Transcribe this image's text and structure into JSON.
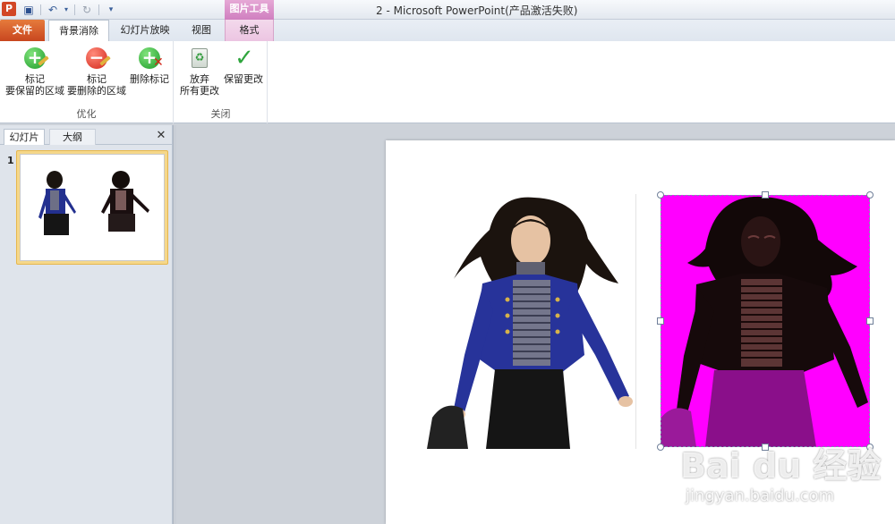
{
  "titlebar": {
    "app_icon_letter": "P",
    "title": "2 - Microsoft PowerPoint(产品激活失败)",
    "context_group_label": "图片工具"
  },
  "tabs": {
    "file": "文件",
    "background_removal": "背景消除",
    "slideshow": "幻灯片放映",
    "view": "视图",
    "format": "格式"
  },
  "ribbon": {
    "refine_group": {
      "label": "优化",
      "mark_keep_line1": "标记",
      "mark_keep_line2": "要保留的区域",
      "mark_remove_line1": "标记",
      "mark_remove_line2": "要删除的区域",
      "delete_mark": "删除标记"
    },
    "close_group": {
      "label": "关闭",
      "discard_line1": "放弃",
      "discard_line2": "所有更改",
      "keep_changes": "保留更改"
    }
  },
  "left_pane": {
    "tab_slides": "幻灯片",
    "tab_outline": "大纲",
    "close_glyph": "✕",
    "slide_number": "1"
  },
  "watermark": {
    "brand": "Bai du 经验",
    "url": "jingyan.baidu.com"
  },
  "colors": {
    "file_tab": "#c8461f",
    "context_tab": "#d07fc0",
    "removal_magenta": "#ff00ff",
    "thumb_highlight": "#f5d78a"
  }
}
